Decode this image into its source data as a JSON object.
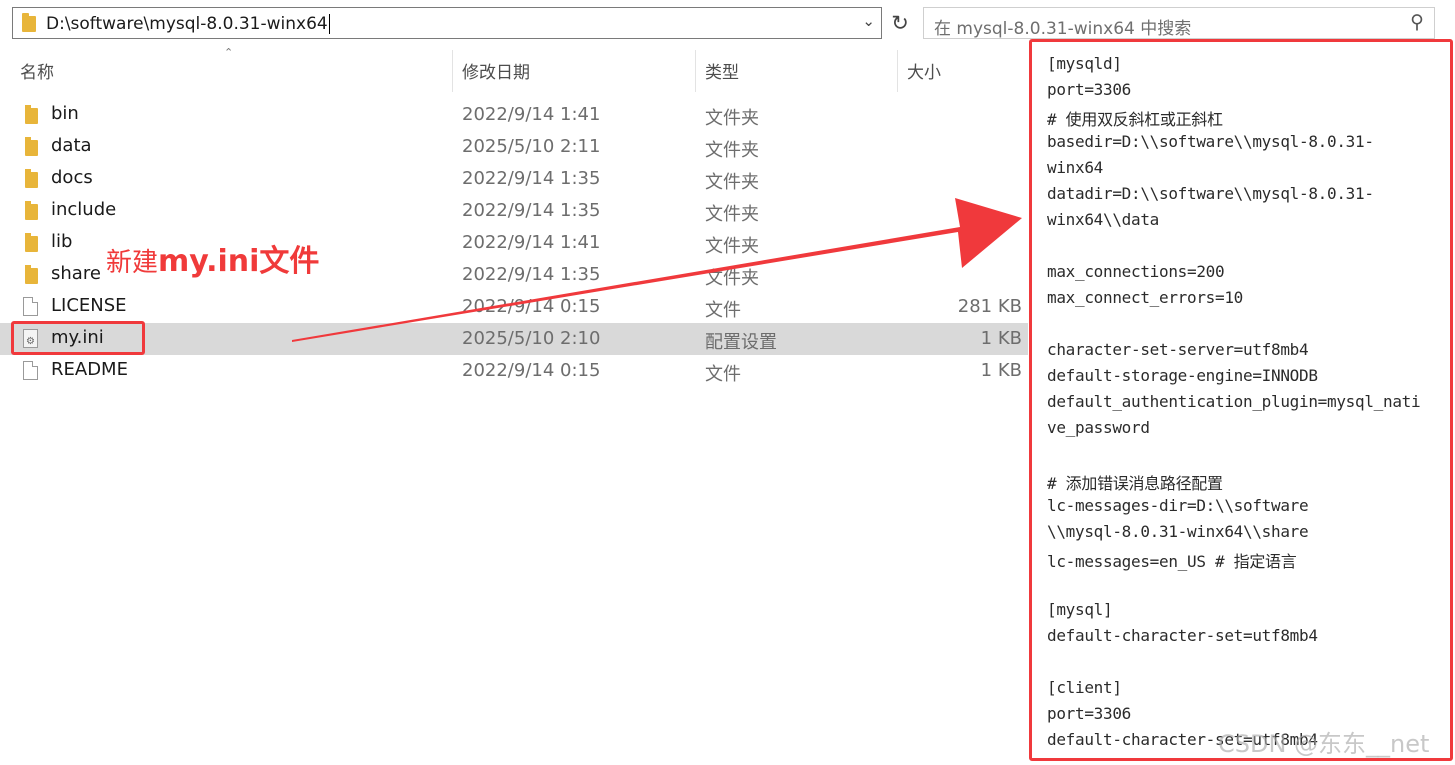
{
  "address_bar": {
    "path": "D:\\software\\mysql-8.0.31-winx64"
  },
  "search": {
    "placeholder": "在 mysql-8.0.31-winx64 中搜索"
  },
  "columns": {
    "name": "名称",
    "date": "修改日期",
    "type": "类型",
    "size": "大小"
  },
  "files": [
    {
      "name": "bin",
      "date": "2022/9/14 1:41",
      "type": "文件夹",
      "size": "",
      "icon": "folder-icon"
    },
    {
      "name": "data",
      "date": "2025/5/10 2:11",
      "type": "文件夹",
      "size": "",
      "icon": "folder-icon"
    },
    {
      "name": "docs",
      "date": "2022/9/14 1:35",
      "type": "文件夹",
      "size": "",
      "icon": "folder-icon"
    },
    {
      "name": "include",
      "date": "2022/9/14 1:35",
      "type": "文件夹",
      "size": "",
      "icon": "folder-icon"
    },
    {
      "name": "lib",
      "date": "2022/9/14 1:41",
      "type": "文件夹",
      "size": "",
      "icon": "folder-icon"
    },
    {
      "name": "share",
      "date": "2022/9/14 1:35",
      "type": "文件夹",
      "size": "",
      "icon": "folder-icon"
    },
    {
      "name": "LICENSE",
      "date": "2022/9/14 0:15",
      "type": "文件",
      "size": "281 KB",
      "icon": "file-icon"
    },
    {
      "name": "my.ini",
      "date": "2025/5/10 2:10",
      "type": "配置设置",
      "size": "1 KB",
      "icon": "config-file-icon"
    },
    {
      "name": "README",
      "date": "2022/9/14 0:15",
      "type": "文件",
      "size": "1 KB",
      "icon": "file-icon"
    }
  ],
  "selected_file": "my.ini",
  "annotation": {
    "prefix": "新建",
    "filename": "my.ini",
    "suffix": "文件"
  },
  "config_lines": [
    "[mysqld]",
    "port=3306",
    "# 使用双反斜杠或正斜杠",
    "basedir=D:\\\\software\\\\mysql-8.0.31-",
    "winx64",
    "datadir=D:\\\\software\\\\mysql-8.0.31-",
    "winx64\\\\data",
    "",
    "max_connections=200",
    "max_connect_errors=10",
    "",
    "character-set-server=utf8mb4",
    "default-storage-engine=INNODB",
    "default_authentication_plugin=mysql_nati",
    "ve_password",
    "",
    "# 添加错误消息路径配置",
    "lc-messages-dir=D:\\\\software",
    "\\\\mysql-8.0.31-winx64\\\\share",
    "lc-messages=en_US  # 指定语言",
    "",
    "[mysql]",
    "default-character-set=utf8mb4",
    "",
    "[client]",
    "port=3306",
    "default-character-set=utf8mb4"
  ],
  "watermark": "CSDN @东东__net",
  "colors": {
    "annotation_red": "#f0393c",
    "folder_yellow": "#e8b53a",
    "selected_row": "#d9d9d9"
  }
}
